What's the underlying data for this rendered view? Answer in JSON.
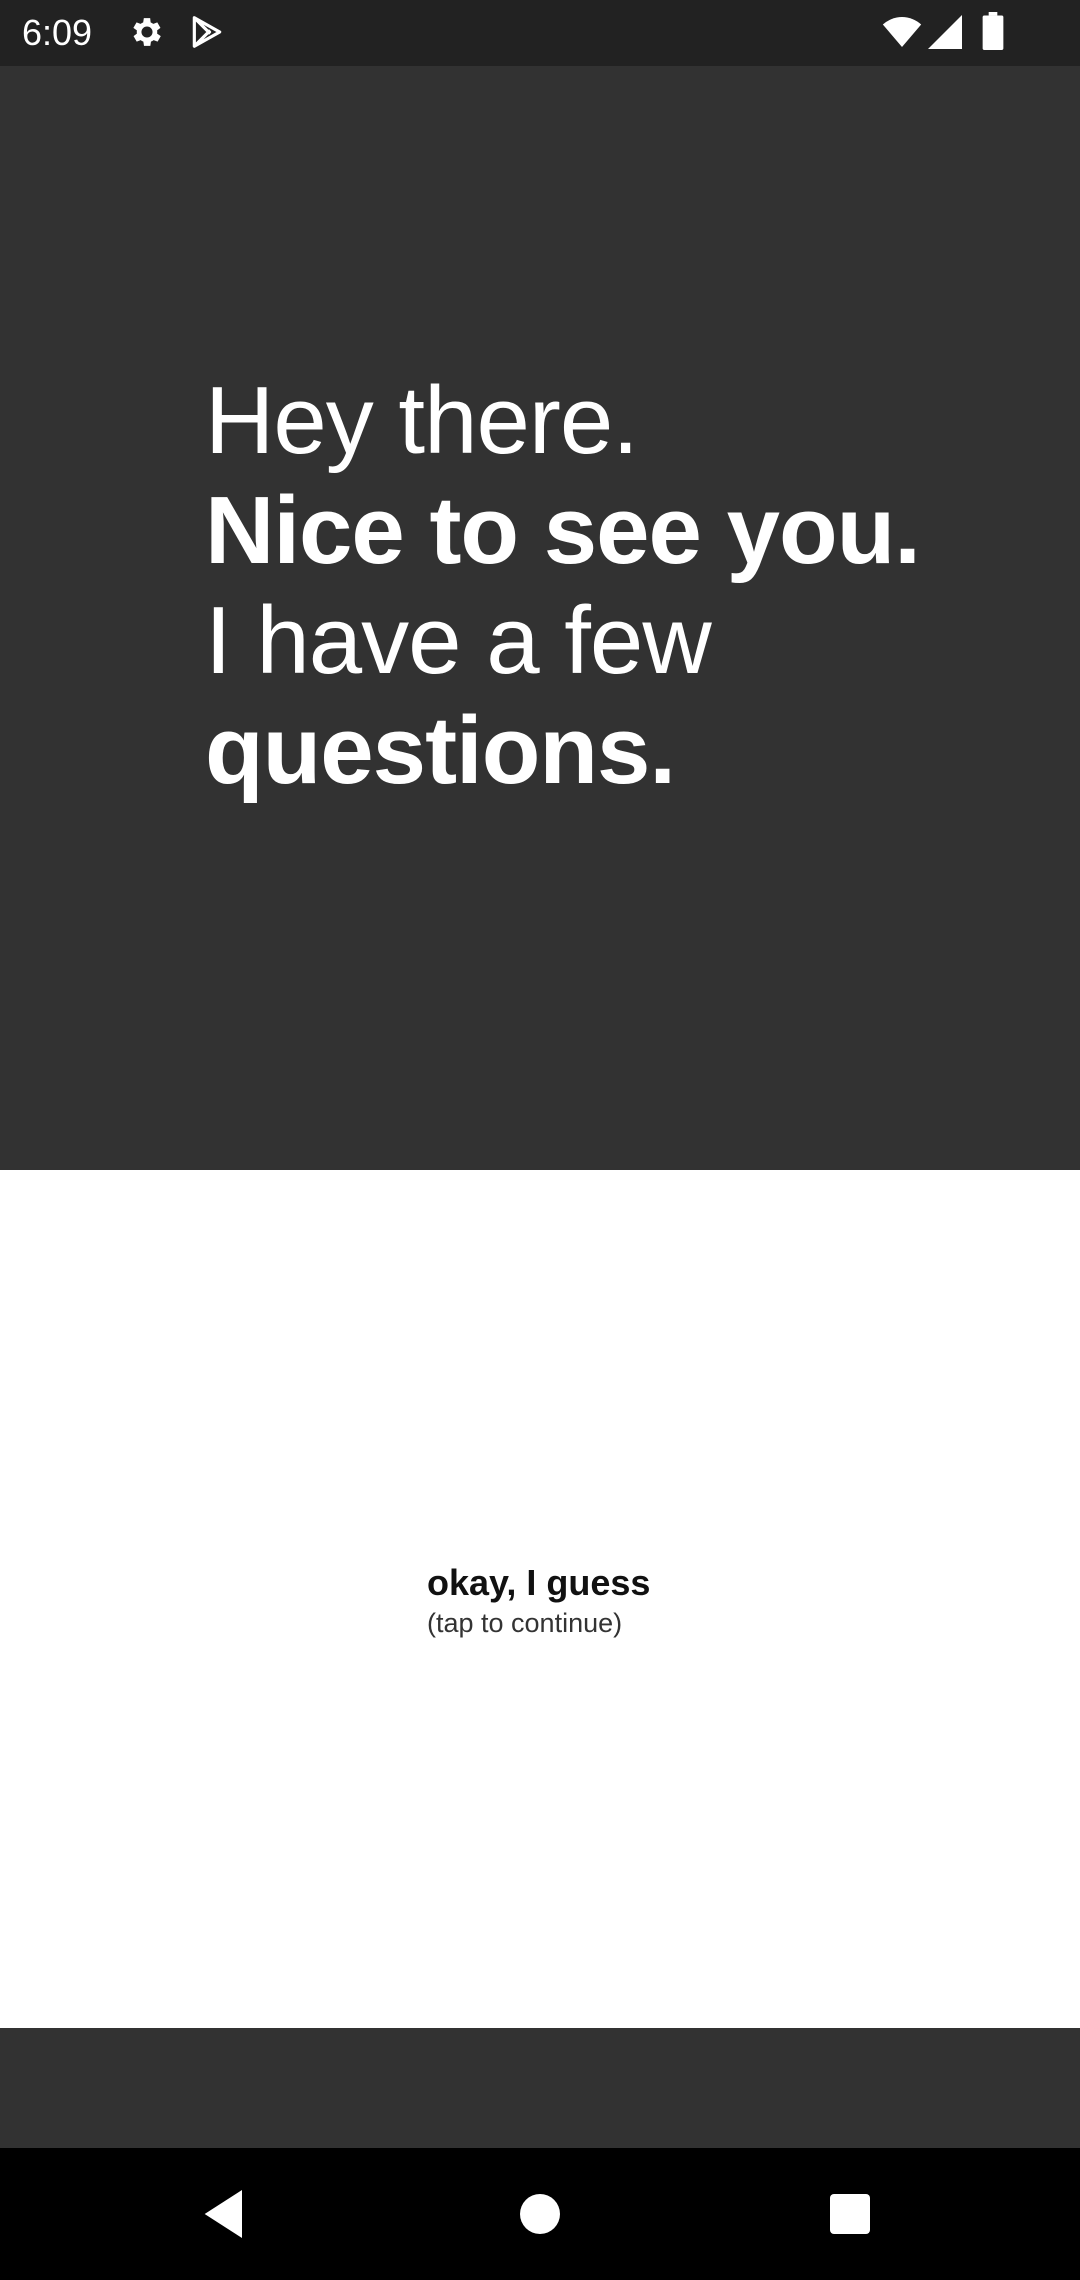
{
  "status_bar": {
    "time": "6:09",
    "left_icons": [
      "gear-icon",
      "play-store-icon"
    ],
    "right_icons": [
      "wifi-icon",
      "signal-icon",
      "battery-icon"
    ]
  },
  "intro": {
    "line1": "Hey there.",
    "line2": "Nice to see you.",
    "line3": "I have a few",
    "line4": "questions."
  },
  "continue": {
    "label": "okay, I guess",
    "hint": "(tap to continue)"
  },
  "nav_bar": {
    "buttons": [
      "back-icon",
      "home-icon",
      "recents-icon"
    ]
  },
  "colors": {
    "background_dark": "#323232",
    "status_bar": "#222222",
    "panel": "#ffffff",
    "nav_bar": "#000000"
  }
}
